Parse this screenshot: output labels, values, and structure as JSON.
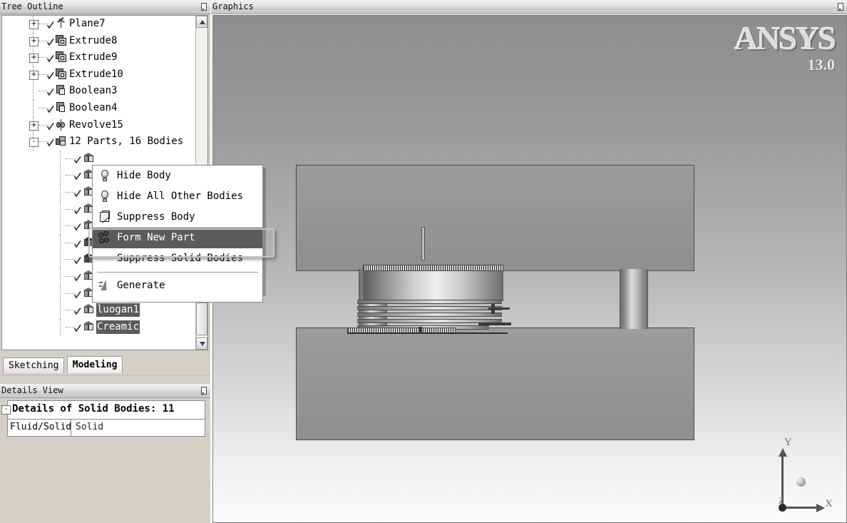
{
  "tree_panel": {
    "title": "Tree Outline",
    "pin_icon": "pin-icon",
    "items": [
      {
        "label": "Plane7",
        "icon": "plane-icon",
        "expander": "+",
        "depth": 0,
        "checked": true,
        "selected": false
      },
      {
        "label": "Extrude8",
        "icon": "extrude-icon",
        "expander": "+",
        "depth": 0,
        "checked": true,
        "selected": false
      },
      {
        "label": "Extrude9",
        "icon": "extrude-icon",
        "expander": "+",
        "depth": 0,
        "checked": true,
        "selected": false
      },
      {
        "label": "Extrude10",
        "icon": "extrude-icon",
        "expander": "+",
        "depth": 0,
        "checked": true,
        "selected": false
      },
      {
        "label": "Boolean3",
        "icon": "boolean-icon",
        "expander": "",
        "depth": 0,
        "checked": true,
        "selected": false
      },
      {
        "label": "Boolean4",
        "icon": "boolean-icon",
        "expander": "",
        "depth": 0,
        "checked": true,
        "selected": false
      },
      {
        "label": "Revolve15",
        "icon": "revolve-icon",
        "expander": "+",
        "depth": 0,
        "checked": true,
        "selected": false
      },
      {
        "label": "12 Parts, 16 Bodies",
        "icon": "parts-icon",
        "expander": "-",
        "depth": 0,
        "checked": true,
        "selected": false
      },
      {
        "label": "",
        "icon": "body-icon",
        "expander": "",
        "depth": 1,
        "checked": true,
        "selected": false
      },
      {
        "label": "",
        "icon": "body-icon",
        "expander": "",
        "depth": 1,
        "checked": true,
        "selected": false
      },
      {
        "label": "",
        "icon": "body-icon",
        "expander": "",
        "depth": 1,
        "checked": true,
        "selected": false
      },
      {
        "label": "",
        "icon": "body-icon",
        "expander": "",
        "depth": 1,
        "checked": true,
        "selected": false
      },
      {
        "label": "",
        "icon": "body-icon",
        "expander": "",
        "depth": 1,
        "checked": true,
        "selected": false
      },
      {
        "label": "",
        "icon": "body-icon-dark",
        "expander": "",
        "depth": 1,
        "checked": true,
        "selected": true
      },
      {
        "label": "",
        "icon": "body-icon-dark",
        "expander": "",
        "depth": 1,
        "checked": true,
        "selected": true
      },
      {
        "label": "",
        "icon": "body-icon",
        "expander": "",
        "depth": 1,
        "checked": true,
        "selected": false
      },
      {
        "label": "",
        "icon": "body-icon",
        "expander": "",
        "depth": 1,
        "checked": true,
        "selected": false
      },
      {
        "label": "luogan1",
        "icon": "body-icon",
        "expander": "",
        "depth": 1,
        "checked": true,
        "selected": true
      },
      {
        "label": "Creamic",
        "icon": "body-icon",
        "expander": "",
        "depth": 1,
        "checked": true,
        "selected": true
      }
    ],
    "scrollbar": {
      "up_icon": "scroll-up-icon",
      "down_icon": "scroll-down-icon"
    }
  },
  "context_menu": {
    "items": [
      {
        "label": "Hide Body",
        "icon": "bulb-icon",
        "highlighted": false,
        "separator_after": false
      },
      {
        "label": "Hide All Other Bodies",
        "icon": "bulb-icon",
        "highlighted": false,
        "separator_after": false
      },
      {
        "label": "Suppress Body",
        "icon": "suppress-icon",
        "highlighted": false,
        "separator_after": false
      },
      {
        "label": "Form New Part",
        "icon": "new-part-icon",
        "highlighted": true,
        "separator_after": false
      },
      {
        "label": "Suppress Solid Bodies",
        "icon": "",
        "highlighted": false,
        "separator_after": true
      },
      {
        "label": "Generate",
        "icon": "generate-icon",
        "highlighted": false,
        "separator_after": false
      }
    ]
  },
  "tabs": [
    {
      "label": "Sketching",
      "active": false
    },
    {
      "label": "Modeling",
      "active": true
    }
  ],
  "details_panel": {
    "title": "Details View",
    "pin_icon": "pin-icon",
    "header": "Details of Solid Bodies: 11",
    "collapse_glyph": "-",
    "rows": [
      {
        "key": "Fluid/Solid",
        "value": "Solid"
      }
    ]
  },
  "graphics_panel": {
    "title": "Graphics",
    "pin_icon": "pin-icon",
    "logo": {
      "mark": "ANSYS",
      "version": "13.0"
    },
    "triad": {
      "y": "Y",
      "x": "X",
      "z": "Z"
    }
  },
  "colors": {
    "panel_chrome": "#d4d0c8",
    "selection": "#5b5b5b",
    "tree_background": "#ffffff",
    "graphics_top": "#8e8e8e",
    "graphics_bottom": "#fbfbfb",
    "model_plate": "#9c9c9c"
  }
}
